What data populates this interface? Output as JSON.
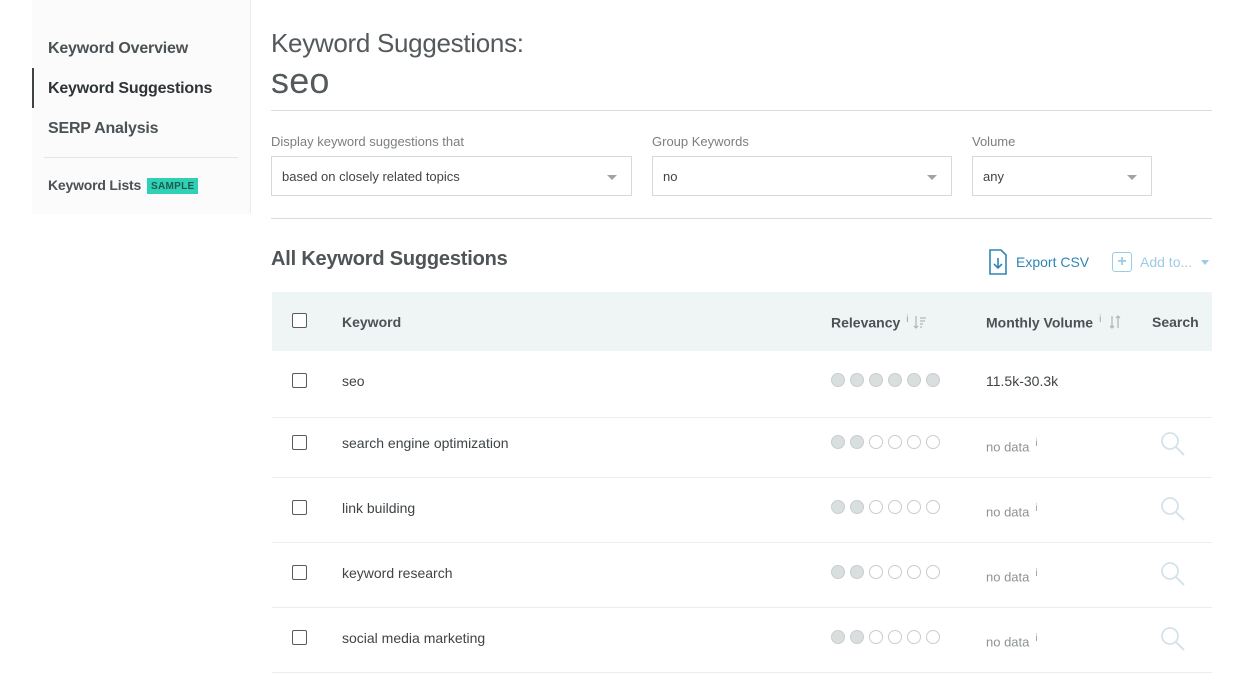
{
  "sidebar": {
    "items": [
      {
        "label": "Keyword Overview"
      },
      {
        "label": "Keyword Suggestions"
      },
      {
        "label": "SERP Analysis"
      }
    ],
    "lists_label": "Keyword Lists",
    "badge": "SAMPLE"
  },
  "header": {
    "title": "Keyword Suggestions:",
    "query": "seo"
  },
  "filters": {
    "display": {
      "label": "Display keyword suggestions that",
      "value": "based on closely related topics"
    },
    "group": {
      "label": "Group Keywords",
      "value": "no"
    },
    "volume": {
      "label": "Volume",
      "value": "any"
    }
  },
  "section": {
    "title": "All Keyword Suggestions",
    "export_label": "Export CSV",
    "add_label": "Add to..."
  },
  "table": {
    "columns": {
      "keyword": "Keyword",
      "relevancy": "Relevancy",
      "volume": "Monthly Volume",
      "search": "Search"
    },
    "info_marker": "i",
    "rows": [
      {
        "keyword": "seo",
        "relevancy": 6,
        "volume": "11.5k-30.3k"
      },
      {
        "keyword": "search engine optimization",
        "relevancy": 2,
        "volume": "no data"
      },
      {
        "keyword": "link building",
        "relevancy": 2,
        "volume": "no data"
      },
      {
        "keyword": "keyword research",
        "relevancy": 2,
        "volume": "no data"
      },
      {
        "keyword": "social media marketing",
        "relevancy": 2,
        "volume": "no data"
      }
    ]
  },
  "colors": {
    "accent": "#2f86b3",
    "badge": "#2fd0b3",
    "header_bg": "#eef5f4"
  },
  "icons": [
    "export-csv-icon",
    "add-icon",
    "sort-icon",
    "info-icon",
    "search-icon"
  ]
}
